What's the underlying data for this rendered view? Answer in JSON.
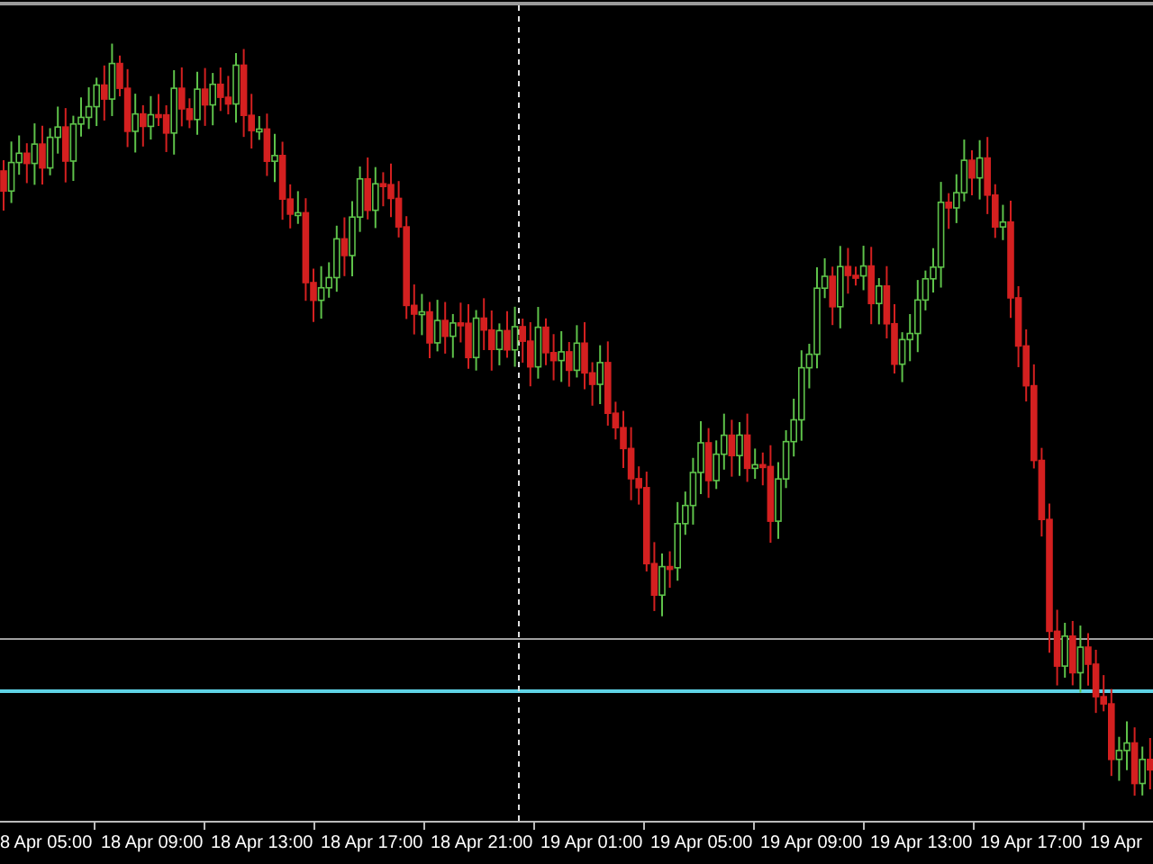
{
  "chart": {
    "time_axis_labels": [
      "8 Apr 05:00",
      "18 Apr 09:00",
      "18 Apr 13:00",
      "18 Apr 17:00",
      "18 Apr 21:00",
      "19 Apr 01:00",
      "19 Apr 05:00",
      "19 Apr 09:00",
      "19 Apr 13:00",
      "19 Apr 17:00",
      "19 Apr"
    ]
  }
}
